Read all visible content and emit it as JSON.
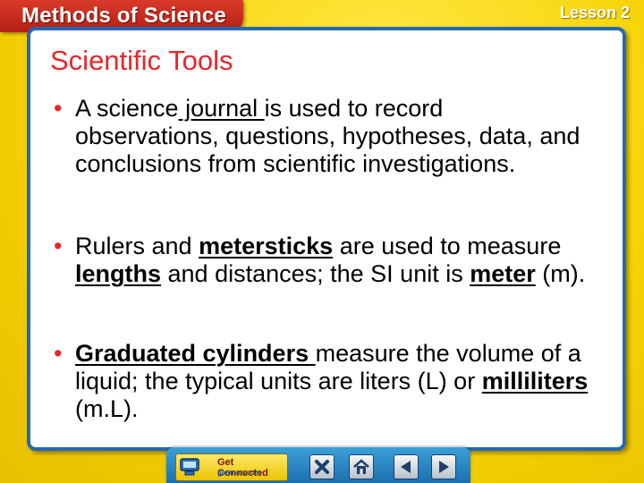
{
  "header": {
    "tab_title": "Methods of Science",
    "lesson_label": "Lesson 2"
  },
  "slide": {
    "title": "Scientific Tools",
    "bullet_char": "•",
    "bullets": [
      {
        "before": "A science",
        "term": " journal ",
        "after": "is used to record observations, questions, hypotheses, data, and conclusions from scientific investigations."
      },
      {
        "p1": "Rulers and ",
        "t1": "metersticks",
        "p2": " are used to measure ",
        "t2": "lengths",
        "p3": " and distances; the SI unit is ",
        "t3": "meter",
        "p4": " (m)."
      },
      {
        "t1": "Graduated cylinders ",
        "p1": "measure the volume of a liquid; the typical units are liters (L) or ",
        "t2": "milliliters",
        "p2": " (m.L)."
      }
    ]
  },
  "navbar": {
    "get_connected_line1": "Get Connected",
    "get_connected_line2": "glencoe.com",
    "buttons": [
      {
        "icon": "close-icon"
      },
      {
        "icon": "home-icon"
      },
      {
        "icon": "back-arrow-icon"
      },
      {
        "icon": "forward-arrow-icon"
      }
    ]
  },
  "colors": {
    "accent_red": "#e8262a",
    "panel_border": "#2469b3",
    "background": "#f5d400"
  }
}
